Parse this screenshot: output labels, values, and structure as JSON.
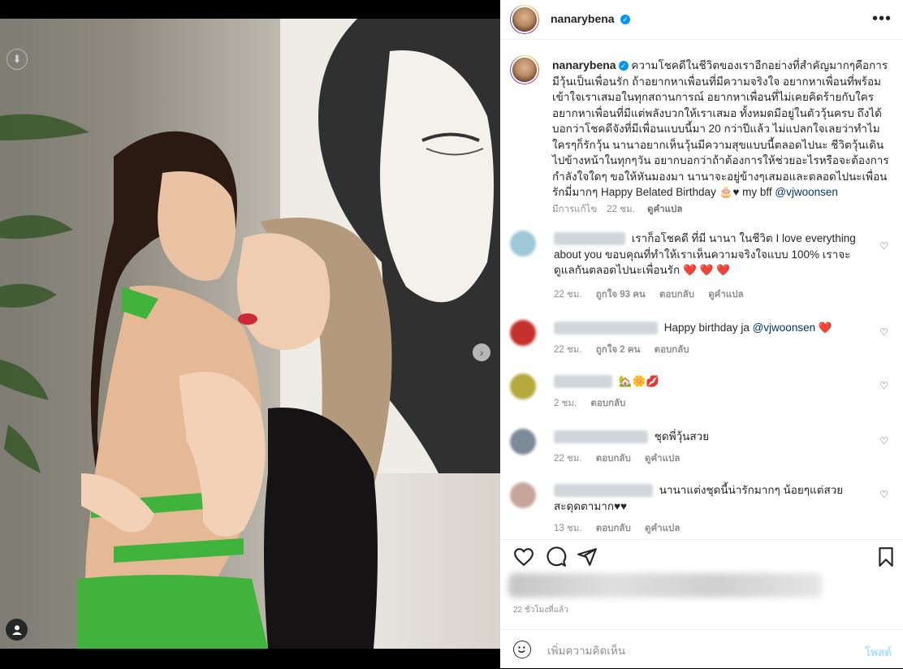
{
  "post": {
    "username": "nanarybena",
    "verified": true,
    "image_alt": "Two women embracing in front of a painting",
    "carousel": {
      "count": 6,
      "active_index": 0
    }
  },
  "caption": {
    "text": "ความโชคดีในชีวิตของเราอีกอย่างที่สำคัญมากๆคือการมีวุ้นเป็นเพื่อนรัก ถ้าอยากหาเพื่อนที่มีความจริงใจ อยากหาเพื่อนที่พร้อมเข้าใจเราเสมอในทุกสถานการณ์ อยากหาเพื่อนที่ไม่เคยคิดร้ายกับใคร อยากหาเพื่อนที่มีแต่พลังบวกให้เราเสมอ ทั้งหมดมีอยู่ในตัววุ้นครบ ถึงได้บอกว่าโชคดีจังที่มีเพื่อนแบบนี้มา 20 กว่าปีแล้ว ไม่แปลกใจเลยว่าทำไมใครๆก็รักวุ้น นานาอยากเห็นวุ้นมีความสุขแบบนี้ตลอดไปนะ ชีวิตวุ้นเดินไปข้างหน้าในทุกๆวัน อยากบอกว่าถ้าต้องการให้ช่วยอะไรหรือจะต้องการกำลังใจใดๆ ขอให้หันมองมา นานาจะอยู่ข้างๆเสมอและตลอดไปนะเพื่อน รักมี่มากๆ Happy Belated Birthday 🎂♥ my bff",
    "mention": "@vjwoonsen",
    "edited_label": "มีการแก้ไข",
    "time": "22 ชม.",
    "translate": "ดูคำแปล"
  },
  "comments": [
    {
      "text": "เราก็อโชคดี ที่มี นานา ในชีวิต I love everything about you ขอบคุณที่ทำให้เราเห็นความจริงใจแบบ 100% เราจะดูแลกันตลอดไปนะเพื่อนรัก",
      "emoji": "❤️ ❤️ ❤️",
      "time": "22 ชม.",
      "likes": "ถูกใจ 93 คน",
      "reply": "ตอบกลับ",
      "translate": "ดูคำแปล",
      "avatar_color": "#9ec7d8"
    },
    {
      "text": "Happy birthday ja",
      "mention": "@vjwoonsen",
      "emoji": "❤️",
      "time": "22 ชม.",
      "likes": "ถูกใจ 2 คน",
      "reply": "ตอบกลับ",
      "avatar_color": "#c4302b"
    },
    {
      "text": "",
      "emoji": "🏡🌼💋",
      "time": "2 ชม.",
      "reply": "ตอบกลับ",
      "avatar_color": "#b4a93a"
    },
    {
      "text": "ชุดพี่วุ้นสวย",
      "time": "22 ชม.",
      "reply": "ตอบกลับ",
      "translate": "ดูคำแปล",
      "avatar_color": "#7c8a9a"
    },
    {
      "text": "นานาแต่งชุดนี้น่ารักมากๆ น้อยๆแต่สวยสะดุดตามาก♥♥",
      "time": "13 ชม.",
      "reply": "ตอบกลับ",
      "translate": "ดูคำแปล",
      "avatar_color": "#c8a59a"
    }
  ],
  "timestamp": "22 ชั่วโมงที่แล้ว",
  "comment_input": {
    "placeholder": "เพิ่มความคิดเห็น",
    "post_label": "โพสต์"
  }
}
